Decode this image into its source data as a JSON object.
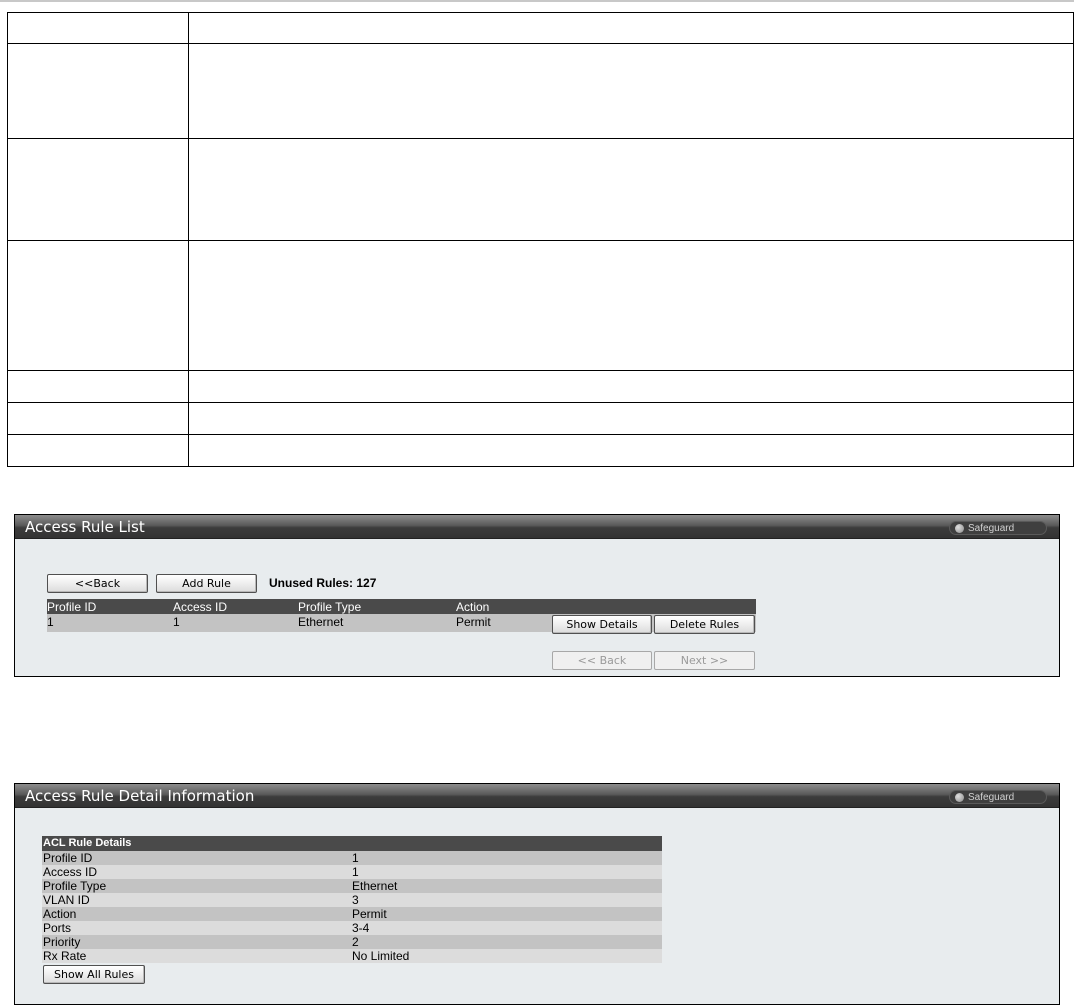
{
  "rule_list": {
    "title": "Access Rule List",
    "safeguard_label": "Safeguard",
    "back_label": "<<Back",
    "add_rule_label": "Add Rule",
    "unused_rules_label": "Unused Rules:",
    "unused_rules_count": "127",
    "columns": [
      "Profile ID",
      "Access ID",
      "Profile Type",
      "Action"
    ],
    "rows": [
      {
        "profile_id": "1",
        "access_id": "1",
        "profile_type": "Ethernet",
        "action": "Permit"
      }
    ],
    "show_details_label": "Show Details",
    "delete_rules_label": "Delete Rules",
    "prev_page_label": "<< Back",
    "next_page_label": "Next >>"
  },
  "rule_detail": {
    "title": "Access Rule Detail Information",
    "safeguard_label": "Safeguard",
    "table_header": "ACL Rule Details",
    "fields": [
      {
        "label": "Profile  ID",
        "value": "1"
      },
      {
        "label": "Access ID",
        "value": "1"
      },
      {
        "label": "Profile Type",
        "value": "Ethernet"
      },
      {
        "label": "VLAN ID",
        "value": "3"
      },
      {
        "label": "Action",
        "value": "Permit"
      },
      {
        "label": "Ports",
        "value": "3-4"
      },
      {
        "label": "Priority",
        "value": "2"
      },
      {
        "label": "Rx Rate",
        "value": "No Limited"
      }
    ],
    "show_all_label": "Show All Rules"
  }
}
